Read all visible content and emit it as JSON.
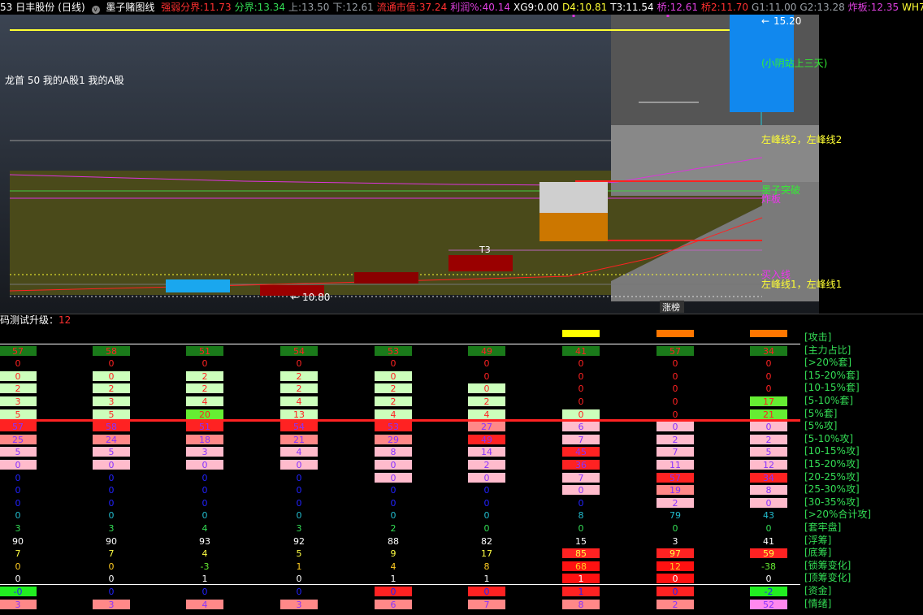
{
  "topbar": {
    "code": "53",
    "stock_name": "日丰股份",
    "period": "(日线)",
    "indicator_name": "墨子赌图线",
    "items": [
      {
        "label": "强弱分界:",
        "value": "11.73",
        "label_color": "#ff3030",
        "value_color": "#ff3030"
      },
      {
        "label": "分界:",
        "value": "13.34",
        "label_color": "#33dd55",
        "value_color": "#33dd55"
      },
      {
        "label": "上:",
        "value": "13.50",
        "label_color": "#9aa0a6",
        "value_color": "#9aa0a6"
      },
      {
        "label": "下:",
        "value": "12.61",
        "label_color": "#9aa0a6",
        "value_color": "#9aa0a6"
      },
      {
        "label": "流通市值:",
        "value": "37.24",
        "label_color": "#ff3030",
        "value_color": "#ff3030"
      },
      {
        "label": "利润%:",
        "value": "40.14",
        "label_color": "#e040e0",
        "value_color": "#e040e0"
      },
      {
        "label": "XG9:",
        "value": "0.00",
        "label_color": "#ffffff",
        "value_color": "#ffffff"
      },
      {
        "label": "D4:",
        "value": "10.81",
        "label_color": "#ffff33",
        "value_color": "#ffff33"
      },
      {
        "label": "T3:",
        "value": "11.54",
        "label_color": "#ffffff",
        "value_color": "#ffffff"
      },
      {
        "label": "桥:",
        "value": "12.61",
        "label_color": "#e040e0",
        "value_color": "#e040e0"
      },
      {
        "label": "桥2:",
        "value": "11.70",
        "label_color": "#ff3030",
        "value_color": "#ff3030"
      },
      {
        "label": "G1:",
        "value": "11.00",
        "label_color": "#9aa0a6",
        "value_color": "#9aa0a6"
      },
      {
        "label": "G2:",
        "value": "13.28",
        "label_color": "#9aa0a6",
        "value_color": "#9aa0a6"
      },
      {
        "label": "炸板:",
        "value": "12.35",
        "label_color": "#e040e0",
        "value_color": "#e040e0"
      },
      {
        "label": "WH7:",
        "value": "",
        "label_color": "#ffff33",
        "value_color": "#ffff33"
      }
    ]
  },
  "chart": {
    "sector_text": "龙首 50 我的A股1 我的A股",
    "price_high": "15.20",
    "price_low": "10.80",
    "label_t3": "T3",
    "label_green_note": "(小阴站上三天)",
    "label_peak2": "左峰线2，左峰线2",
    "label_breakout": "墨子突破",
    "label_zhaban": "炸板",
    "label_buyline": "买入线",
    "label_peak1": "左峰线1，左峰线1",
    "label_limitup": "涨榜"
  },
  "lower": {
    "title": "码测试升级",
    "title_value": "12",
    "header_colors": [
      "#ffff00",
      "#ff7700",
      "#ff7700"
    ],
    "row_labels": [
      "[攻击]",
      "[主力占比]",
      "[>20%套]",
      "[15-20%套]",
      "[10-15%套]",
      "[5-10%套]",
      "[5%套]",
      "[5%攻]",
      "[5-10%攻]",
      "[10-15%攻]",
      "[15-20%攻]",
      "[20-25%攻]",
      "[25-30%攻]",
      "[30-35%攻]",
      "[>20%合计攻]",
      "[套牢盘]",
      "[浮筹]",
      "[底筹]",
      "[锁筹变化]",
      "[顶筹变化]",
      "[资金]",
      "[情绪]"
    ],
    "rows": [
      [],
      [
        {
          "v": "57",
          "c": "#ff2222",
          "bg": "#1a7a1a"
        },
        {
          "v": "58",
          "c": "#ff2222",
          "bg": "#1a7a1a"
        },
        {
          "v": "51",
          "c": "#ff2222",
          "bg": "#1a7a1a"
        },
        {
          "v": "54",
          "c": "#ff2222",
          "bg": "#1a7a1a"
        },
        {
          "v": "53",
          "c": "#ff2222",
          "bg": "#1a7a1a"
        },
        {
          "v": "49",
          "c": "#ff2222",
          "bg": "#1a7a1a"
        },
        {
          "v": "41",
          "c": "#ff2222",
          "bg": "#1a7a1a"
        },
        {
          "v": "57",
          "c": "#ff2222",
          "bg": "#1a7a1a"
        },
        {
          "v": "34",
          "c": "#ff2222",
          "bg": "#1a7a1a"
        }
      ],
      [
        {
          "v": "0",
          "c": "#ff2222"
        },
        {
          "v": "0",
          "c": "#ff2222"
        },
        {
          "v": "0",
          "c": "#ff2222"
        },
        {
          "v": "0",
          "c": "#ff2222"
        },
        {
          "v": "0",
          "c": "#ff2222"
        },
        {
          "v": "0",
          "c": "#ff2222"
        },
        {
          "v": "0",
          "c": "#ff2222"
        },
        {
          "v": "0",
          "c": "#ff2222"
        },
        {
          "v": "0",
          "c": "#ff2222"
        }
      ],
      [
        {
          "v": "0",
          "c": "#ff2222",
          "bg": "#ccffbb"
        },
        {
          "v": "0",
          "c": "#ff2222",
          "bg": "#ccffbb"
        },
        {
          "v": "2",
          "c": "#ff2222",
          "bg": "#ccffbb"
        },
        {
          "v": "2",
          "c": "#ff2222",
          "bg": "#ccffbb"
        },
        {
          "v": "0",
          "c": "#ff2222",
          "bg": "#ccffbb"
        },
        {
          "v": "0",
          "c": "#ff2222"
        },
        {
          "v": "0",
          "c": "#ff2222"
        },
        {
          "v": "0",
          "c": "#ff2222"
        },
        {
          "v": "0",
          "c": "#ff2222"
        }
      ],
      [
        {
          "v": "2",
          "c": "#ff2222",
          "bg": "#ccffbb"
        },
        {
          "v": "2",
          "c": "#ff2222",
          "bg": "#ccffbb"
        },
        {
          "v": "2",
          "c": "#ff2222",
          "bg": "#ccffbb"
        },
        {
          "v": "2",
          "c": "#ff2222",
          "bg": "#ccffbb"
        },
        {
          "v": "2",
          "c": "#ff2222",
          "bg": "#ccffbb"
        },
        {
          "v": "0",
          "c": "#ff2222",
          "bg": "#ccffbb"
        },
        {
          "v": "0",
          "c": "#ff2222"
        },
        {
          "v": "0",
          "c": "#ff2222"
        },
        {
          "v": "0",
          "c": "#ff2222"
        }
      ],
      [
        {
          "v": "3",
          "c": "#ff2222",
          "bg": "#ccffbb"
        },
        {
          "v": "3",
          "c": "#ff2222",
          "bg": "#ccffbb"
        },
        {
          "v": "4",
          "c": "#ff2222",
          "bg": "#ccffbb"
        },
        {
          "v": "4",
          "c": "#ff2222",
          "bg": "#ccffbb"
        },
        {
          "v": "2",
          "c": "#ff2222",
          "bg": "#ccffbb"
        },
        {
          "v": "2",
          "c": "#ff2222",
          "bg": "#ccffbb"
        },
        {
          "v": "0",
          "c": "#ff2222"
        },
        {
          "v": "0",
          "c": "#ff2222"
        },
        {
          "v": "17",
          "c": "#ff2222",
          "bg": "#66ee33"
        }
      ],
      [
        {
          "v": "5",
          "c": "#ff2222",
          "bg": "#ccffbb"
        },
        {
          "v": "5",
          "c": "#ff2222",
          "bg": "#ccffbb"
        },
        {
          "v": "20",
          "c": "#ff2222",
          "bg": "#66ee33"
        },
        {
          "v": "13",
          "c": "#ff2222",
          "bg": "#ccffbb"
        },
        {
          "v": "4",
          "c": "#ff2222",
          "bg": "#ccffbb"
        },
        {
          "v": "4",
          "c": "#ff2222",
          "bg": "#ccffbb"
        },
        {
          "v": "0",
          "c": "#ff2222",
          "bg": "#ccffbb"
        },
        {
          "v": "0",
          "c": "#ff2222"
        },
        {
          "v": "21",
          "c": "#ff2222",
          "bg": "#66ee33"
        }
      ],
      [
        {
          "v": "57",
          "c": "#8833ff",
          "bg": "#ff2222"
        },
        {
          "v": "58",
          "c": "#8833ff",
          "bg": "#ff2222"
        },
        {
          "v": "51",
          "c": "#8833ff",
          "bg": "#ff2222"
        },
        {
          "v": "54",
          "c": "#8833ff",
          "bg": "#ff2222"
        },
        {
          "v": "53",
          "c": "#8833ff",
          "bg": "#ff2222"
        },
        {
          "v": "27",
          "c": "#8833ff",
          "bg": "#ff8888"
        },
        {
          "v": "6",
          "c": "#8833ff",
          "bg": "#ffbbcc"
        },
        {
          "v": "0",
          "c": "#8833ff",
          "bg": "#ffbbcc"
        },
        {
          "v": "0",
          "c": "#8833ff",
          "bg": "#ffbbcc"
        }
      ],
      [
        {
          "v": "25",
          "c": "#8833ff",
          "bg": "#ff8888"
        },
        {
          "v": "24",
          "c": "#8833ff",
          "bg": "#ff8888"
        },
        {
          "v": "18",
          "c": "#8833ff",
          "bg": "#ff8888"
        },
        {
          "v": "21",
          "c": "#8833ff",
          "bg": "#ff8888"
        },
        {
          "v": "29",
          "c": "#8833ff",
          "bg": "#ff8888"
        },
        {
          "v": "49",
          "c": "#8833ff",
          "bg": "#ff2222"
        },
        {
          "v": "7",
          "c": "#8833ff",
          "bg": "#ffbbcc"
        },
        {
          "v": "2",
          "c": "#8833ff",
          "bg": "#ffbbcc"
        },
        {
          "v": "2",
          "c": "#8833ff",
          "bg": "#ffbbcc"
        }
      ],
      [
        {
          "v": "5",
          "c": "#8833ff",
          "bg": "#ffbbcc"
        },
        {
          "v": "5",
          "c": "#8833ff",
          "bg": "#ffbbcc"
        },
        {
          "v": "3",
          "c": "#8833ff",
          "bg": "#ffbbcc"
        },
        {
          "v": "4",
          "c": "#8833ff",
          "bg": "#ffbbcc"
        },
        {
          "v": "8",
          "c": "#8833ff",
          "bg": "#ffbbcc"
        },
        {
          "v": "14",
          "c": "#8833ff",
          "bg": "#ffbbcc"
        },
        {
          "v": "45",
          "c": "#8833ff",
          "bg": "#ff2222"
        },
        {
          "v": "7",
          "c": "#8833ff",
          "bg": "#ffbbcc"
        },
        {
          "v": "5",
          "c": "#8833ff",
          "bg": "#ffbbcc"
        }
      ],
      [
        {
          "v": "0",
          "c": "#8833ff",
          "bg": "#ffbbcc"
        },
        {
          "v": "0",
          "c": "#8833ff",
          "bg": "#ffbbcc"
        },
        {
          "v": "0",
          "c": "#8833ff",
          "bg": "#ffbbcc"
        },
        {
          "v": "0",
          "c": "#8833ff",
          "bg": "#ffbbcc"
        },
        {
          "v": "0",
          "c": "#8833ff",
          "bg": "#ffbbcc"
        },
        {
          "v": "2",
          "c": "#8833ff",
          "bg": "#ffbbcc"
        },
        {
          "v": "36",
          "c": "#8833ff",
          "bg": "#ff2222"
        },
        {
          "v": "11",
          "c": "#8833ff",
          "bg": "#ffbbcc"
        },
        {
          "v": "12",
          "c": "#8833ff",
          "bg": "#ffbbcc"
        }
      ],
      [
        {
          "v": "0",
          "c": "#2222ff"
        },
        {
          "v": "0",
          "c": "#2222ff"
        },
        {
          "v": "0",
          "c": "#2222ff"
        },
        {
          "v": "0",
          "c": "#2222ff"
        },
        {
          "v": "0",
          "c": "#8833ff",
          "bg": "#ffbbcc"
        },
        {
          "v": "0",
          "c": "#8833ff",
          "bg": "#ffbbcc"
        },
        {
          "v": "7",
          "c": "#8833ff",
          "bg": "#ffbbcc"
        },
        {
          "v": "57",
          "c": "#8833ff",
          "bg": "#ff2222"
        },
        {
          "v": "34",
          "c": "#8833ff",
          "bg": "#ff2222"
        }
      ],
      [
        {
          "v": "0",
          "c": "#2222ff"
        },
        {
          "v": "0",
          "c": "#2222ff"
        },
        {
          "v": "0",
          "c": "#2222ff"
        },
        {
          "v": "0",
          "c": "#2222ff"
        },
        {
          "v": "0",
          "c": "#2222ff"
        },
        {
          "v": "0",
          "c": "#2222ff"
        },
        {
          "v": "0",
          "c": "#8833ff",
          "bg": "#ffbbcc"
        },
        {
          "v": "19",
          "c": "#8833ff",
          "bg": "#ff8888"
        },
        {
          "v": "8",
          "c": "#8833ff",
          "bg": "#ffbbcc"
        }
      ],
      [
        {
          "v": "0",
          "c": "#2222ff"
        },
        {
          "v": "0",
          "c": "#2222ff"
        },
        {
          "v": "0",
          "c": "#2222ff"
        },
        {
          "v": "0",
          "c": "#2222ff"
        },
        {
          "v": "0",
          "c": "#2222ff"
        },
        {
          "v": "0",
          "c": "#2222ff"
        },
        {
          "v": "0",
          "c": "#2222ff"
        },
        {
          "v": "2",
          "c": "#8833ff",
          "bg": "#ffbbcc"
        },
        {
          "v": "0",
          "c": "#8833ff",
          "bg": "#ffbbcc"
        }
      ],
      [
        {
          "v": "0",
          "c": "#22bbcc"
        },
        {
          "v": "0",
          "c": "#22bbcc"
        },
        {
          "v": "0",
          "c": "#22bbcc"
        },
        {
          "v": "0",
          "c": "#22bbcc"
        },
        {
          "v": "0",
          "c": "#22bbcc"
        },
        {
          "v": "0",
          "c": "#22bbcc"
        },
        {
          "v": "8",
          "c": "#22bbcc"
        },
        {
          "v": "79",
          "c": "#22bbcc"
        },
        {
          "v": "43",
          "c": "#22bbcc"
        }
      ],
      [
        {
          "v": "3",
          "c": "#33dd55"
        },
        {
          "v": "3",
          "c": "#33dd55"
        },
        {
          "v": "4",
          "c": "#33dd55"
        },
        {
          "v": "3",
          "c": "#33dd55"
        },
        {
          "v": "2",
          "c": "#33dd55"
        },
        {
          "v": "0",
          "c": "#33dd55"
        },
        {
          "v": "0",
          "c": "#33dd55"
        },
        {
          "v": "0",
          "c": "#33dd55"
        },
        {
          "v": "0",
          "c": "#33dd55"
        }
      ],
      [
        {
          "v": "90",
          "c": "#ffffff"
        },
        {
          "v": "90",
          "c": "#ffffff"
        },
        {
          "v": "93",
          "c": "#ffffff"
        },
        {
          "v": "92",
          "c": "#ffffff"
        },
        {
          "v": "88",
          "c": "#ffffff"
        },
        {
          "v": "82",
          "c": "#ffffff"
        },
        {
          "v": "15",
          "c": "#ffffff"
        },
        {
          "v": "3",
          "c": "#ffffff"
        },
        {
          "v": "41",
          "c": "#ffffff"
        }
      ],
      [
        {
          "v": "7",
          "c": "#ffff44"
        },
        {
          "v": "7",
          "c": "#ffff44"
        },
        {
          "v": "4",
          "c": "#ffff44"
        },
        {
          "v": "5",
          "c": "#ffff44"
        },
        {
          "v": "9",
          "c": "#ffff44"
        },
        {
          "v": "17",
          "c": "#ffff44"
        },
        {
          "v": "85",
          "c": "#ffff44",
          "bg": "#ff2222"
        },
        {
          "v": "97",
          "c": "#ffff44",
          "bg": "#ff2222"
        },
        {
          "v": "59",
          "c": "#ffff44",
          "bg": "#ff2222"
        }
      ],
      [
        {
          "v": "0",
          "c": "#ffcc22"
        },
        {
          "v": "0",
          "c": "#ffcc22"
        },
        {
          "v": "-3",
          "c": "#66ee33"
        },
        {
          "v": "1",
          "c": "#ffcc22"
        },
        {
          "v": "4",
          "c": "#ffcc22"
        },
        {
          "v": "8",
          "c": "#ffcc22"
        },
        {
          "v": "68",
          "c": "#ffcc22",
          "bg": "#ff1111"
        },
        {
          "v": "12",
          "c": "#ffcc22",
          "bg": "#ff1111"
        },
        {
          "v": "-38",
          "c": "#66ee33"
        }
      ],
      [
        {
          "v": "0",
          "c": "#ffffff"
        },
        {
          "v": "0",
          "c": "#ffffff"
        },
        {
          "v": "1",
          "c": "#ffffff"
        },
        {
          "v": "0",
          "c": "#ffffff"
        },
        {
          "v": "1",
          "c": "#ffffff"
        },
        {
          "v": "1",
          "c": "#ffffff"
        },
        {
          "v": "1",
          "c": "#ffffff",
          "bg": "#ff1111"
        },
        {
          "v": "0",
          "c": "#ffffff",
          "bg": "#ff1111"
        },
        {
          "v": "0",
          "c": "#ffffff"
        }
      ],
      [
        {
          "v": "-0",
          "c": "#2222ff",
          "bg": "#22ee22"
        },
        {
          "v": "0",
          "c": "#2222ff"
        },
        {
          "v": "0",
          "c": "#2222ff"
        },
        {
          "v": "0",
          "c": "#2222ff"
        },
        {
          "v": "0",
          "c": "#2222ff",
          "bg": "#ff2222"
        },
        {
          "v": "0",
          "c": "#2222ff",
          "bg": "#ff2222"
        },
        {
          "v": "1",
          "c": "#2222ff",
          "bg": "#ff2222"
        },
        {
          "v": "0",
          "c": "#2222ff",
          "bg": "#ff2222"
        },
        {
          "v": "-2",
          "c": "#2222ff",
          "bg": "#22ee22"
        }
      ],
      [
        {
          "v": "3",
          "c": "#8833ff",
          "bg": "#ff8888"
        },
        {
          "v": "3",
          "c": "#8833ff",
          "bg": "#ff8888"
        },
        {
          "v": "4",
          "c": "#8833ff",
          "bg": "#ff8888"
        },
        {
          "v": "3",
          "c": "#8833ff",
          "bg": "#ff8888"
        },
        {
          "v": "6",
          "c": "#8833ff",
          "bg": "#ff8888"
        },
        {
          "v": "7",
          "c": "#8833ff",
          "bg": "#ff8888"
        },
        {
          "v": "8",
          "c": "#8833ff",
          "bg": "#ff8888"
        },
        {
          "v": "2",
          "c": "#8833ff",
          "bg": "#ff8888"
        },
        {
          "v": "52",
          "c": "#8833ff",
          "bg": "#ff88ee"
        }
      ]
    ]
  }
}
